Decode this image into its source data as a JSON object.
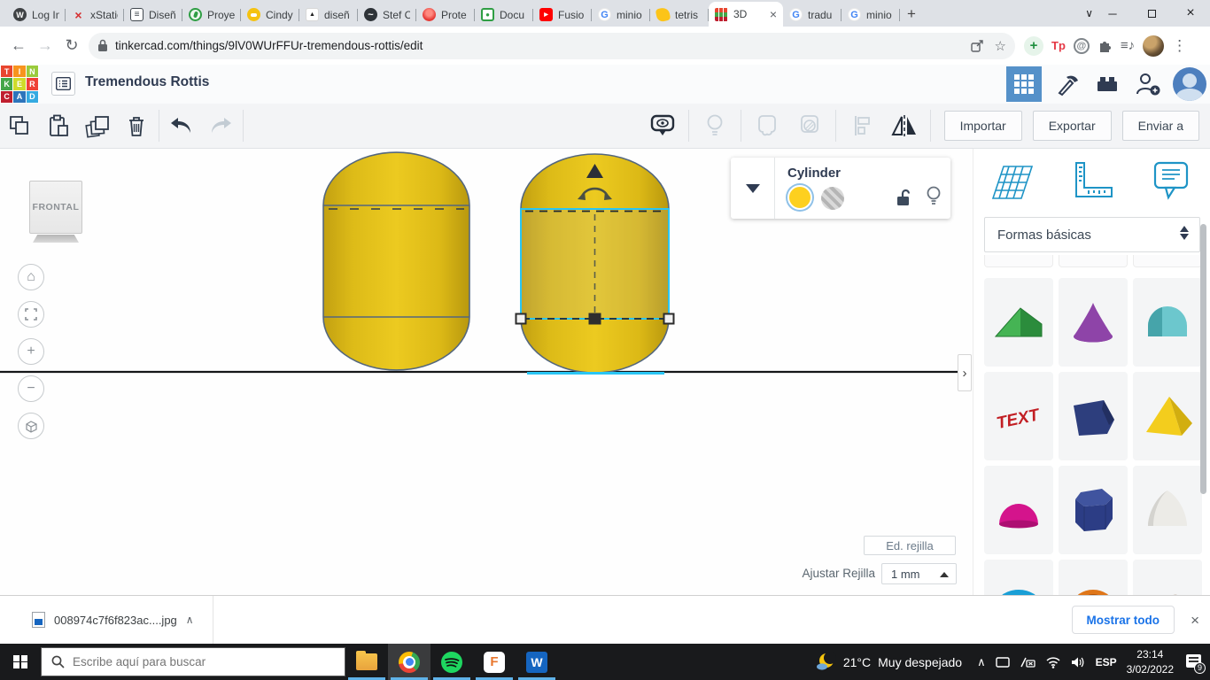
{
  "browser": {
    "tabs": [
      {
        "label": "Log In",
        "icon": "wordpress"
      },
      {
        "label": "xStatic",
        "icon": "xstatic"
      },
      {
        "label": "Diseñ",
        "icon": "book"
      },
      {
        "label": "Proye",
        "icon": "sprout"
      },
      {
        "label": "Cindy",
        "icon": "circle-yellow"
      },
      {
        "label": "diseñ",
        "icon": "triangle"
      },
      {
        "label": "Stef C",
        "icon": "globe"
      },
      {
        "label": "Prote",
        "icon": "bulb-red"
      },
      {
        "label": "Docu",
        "icon": "doc-green"
      },
      {
        "label": "Fusio",
        "icon": "youtube"
      },
      {
        "label": "minio",
        "icon": "google"
      },
      {
        "label": "tetris",
        "icon": "tetris"
      },
      {
        "label": "3D",
        "icon": "tinkercad",
        "active": true
      },
      {
        "label": "tradu",
        "icon": "google"
      },
      {
        "label": "minio",
        "icon": "google"
      }
    ],
    "url": "tinkercad.com/things/9lV0WUrFFUr-tremendous-rottis/edit",
    "tp_badge": "Tp"
  },
  "header": {
    "title": "Tremendous Rottis"
  },
  "toolbar": {
    "import": "Importar",
    "export": "Exportar",
    "send": "Enviar a"
  },
  "inspector": {
    "title": "Cylinder",
    "shape_color": "#fdd01f",
    "selection_color": "#29c5f4"
  },
  "viewcube": {
    "label": "FRONTAL"
  },
  "shapes_panel": {
    "category": "Formas básicas",
    "tiles": [
      {
        "name": "roof",
        "color": "#3fae4f"
      },
      {
        "name": "cone",
        "color": "#8e44a8"
      },
      {
        "name": "round-roof",
        "color": "#5fc3c9"
      },
      {
        "name": "text",
        "color": "#c21f24"
      },
      {
        "name": "polygon",
        "color": "#2d3e7d"
      },
      {
        "name": "pyramid",
        "color": "#f3cd1d"
      },
      {
        "name": "paraboloid",
        "color": "#d4148c"
      },
      {
        "name": "hexagonal-prism",
        "color": "#2c3d85"
      },
      {
        "name": "half-sphere",
        "color": "#ecebe7"
      },
      {
        "name": "torus",
        "color": "#1a9fd6"
      },
      {
        "name": "tube",
        "color": "#df7619"
      },
      {
        "name": "scribble",
        "color": "#8d6a4b"
      }
    ]
  },
  "grid": {
    "edit_label": "Ed. rejilla",
    "snap_label": "Ajustar Rejilla",
    "snap_value": "1 mm"
  },
  "download": {
    "filename": "008974c7f6f823ac....jpg",
    "show_all": "Mostrar todo"
  },
  "taskbar": {
    "search_placeholder": "Escribe aquí para buscar",
    "temp": "21°C",
    "weather": "Muy despejado",
    "lang": "ESP",
    "time": "23:14",
    "date": "3/02/2022",
    "notifications": "9"
  }
}
